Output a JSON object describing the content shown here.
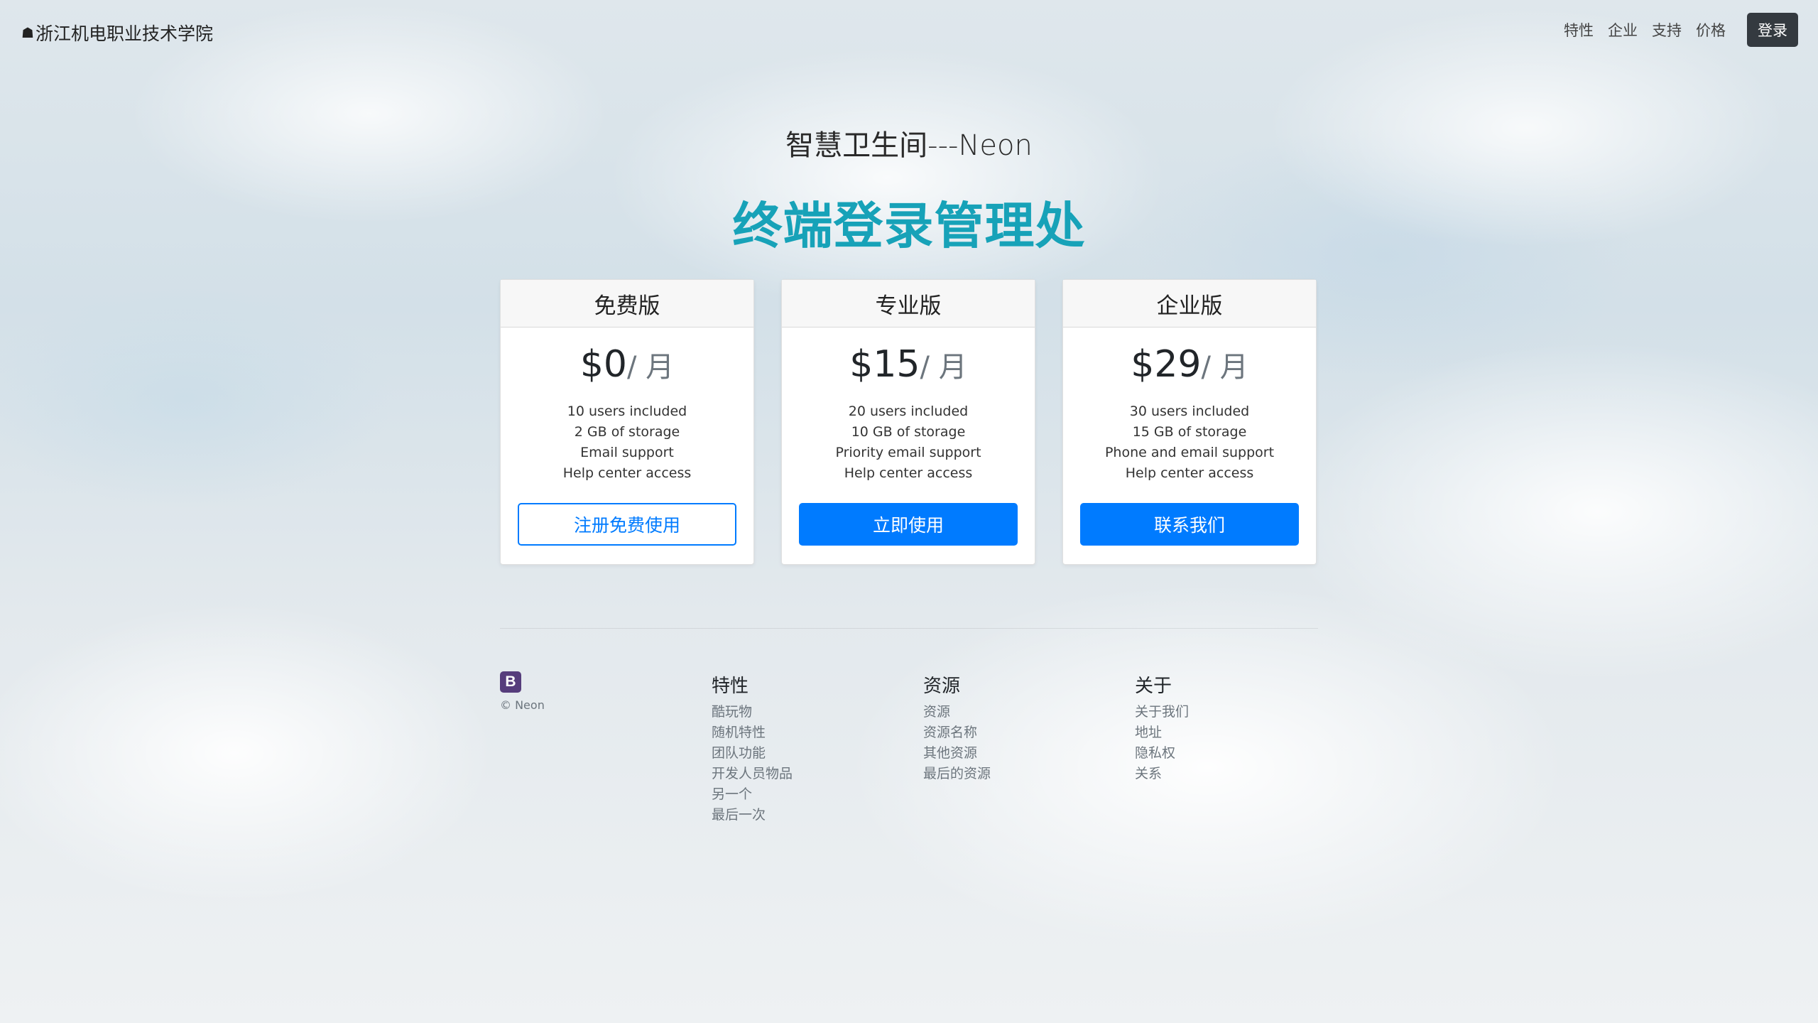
{
  "nav": {
    "brand_icon": "home-icon",
    "brand": "浙江机电职业技术学院",
    "links": [
      "特性",
      "企业",
      "支持",
      "价格"
    ],
    "login_label": "登录"
  },
  "hero": {
    "subtitle": "智慧卫生间---Neon",
    "title": "终端登录管理处"
  },
  "plans": [
    {
      "name": "免费版",
      "price": "$0",
      "period": "/ 月",
      "features": [
        "10 users included",
        "2 GB of storage",
        "Email support",
        "Help center access"
      ],
      "button": "注册免费使用"
    },
    {
      "name": "专业版",
      "price": "$15",
      "period": "/ 月",
      "features": [
        "20 users included",
        "10 GB of storage",
        "Priority email support",
        "Help center access"
      ],
      "button": "立即使用"
    },
    {
      "name": "企业版",
      "price": "$29",
      "period": "/ 月",
      "features": [
        "30 users included",
        "15 GB of storage",
        "Phone and email support",
        "Help center access"
      ],
      "button": "联系我们"
    }
  ],
  "footer": {
    "logo_letter": "B",
    "copyright": "© Neon",
    "columns": [
      {
        "title": "特性",
        "items": [
          "酷玩物",
          "随机特性",
          "团队功能",
          "开发人员物品",
          "另一个",
          "最后一次"
        ]
      },
      {
        "title": "资源",
        "items": [
          "资源",
          "资源名称",
          "其他资源",
          "最后的资源"
        ]
      },
      {
        "title": "关于",
        "items": [
          "关于我们",
          "地址",
          "隐私权",
          "关系"
        ]
      }
    ]
  },
  "colors": {
    "accent_title": "#17a2b8",
    "primary_button": "#007bff",
    "login_button": "#343a40",
    "footer_logo": "#563d7c"
  }
}
